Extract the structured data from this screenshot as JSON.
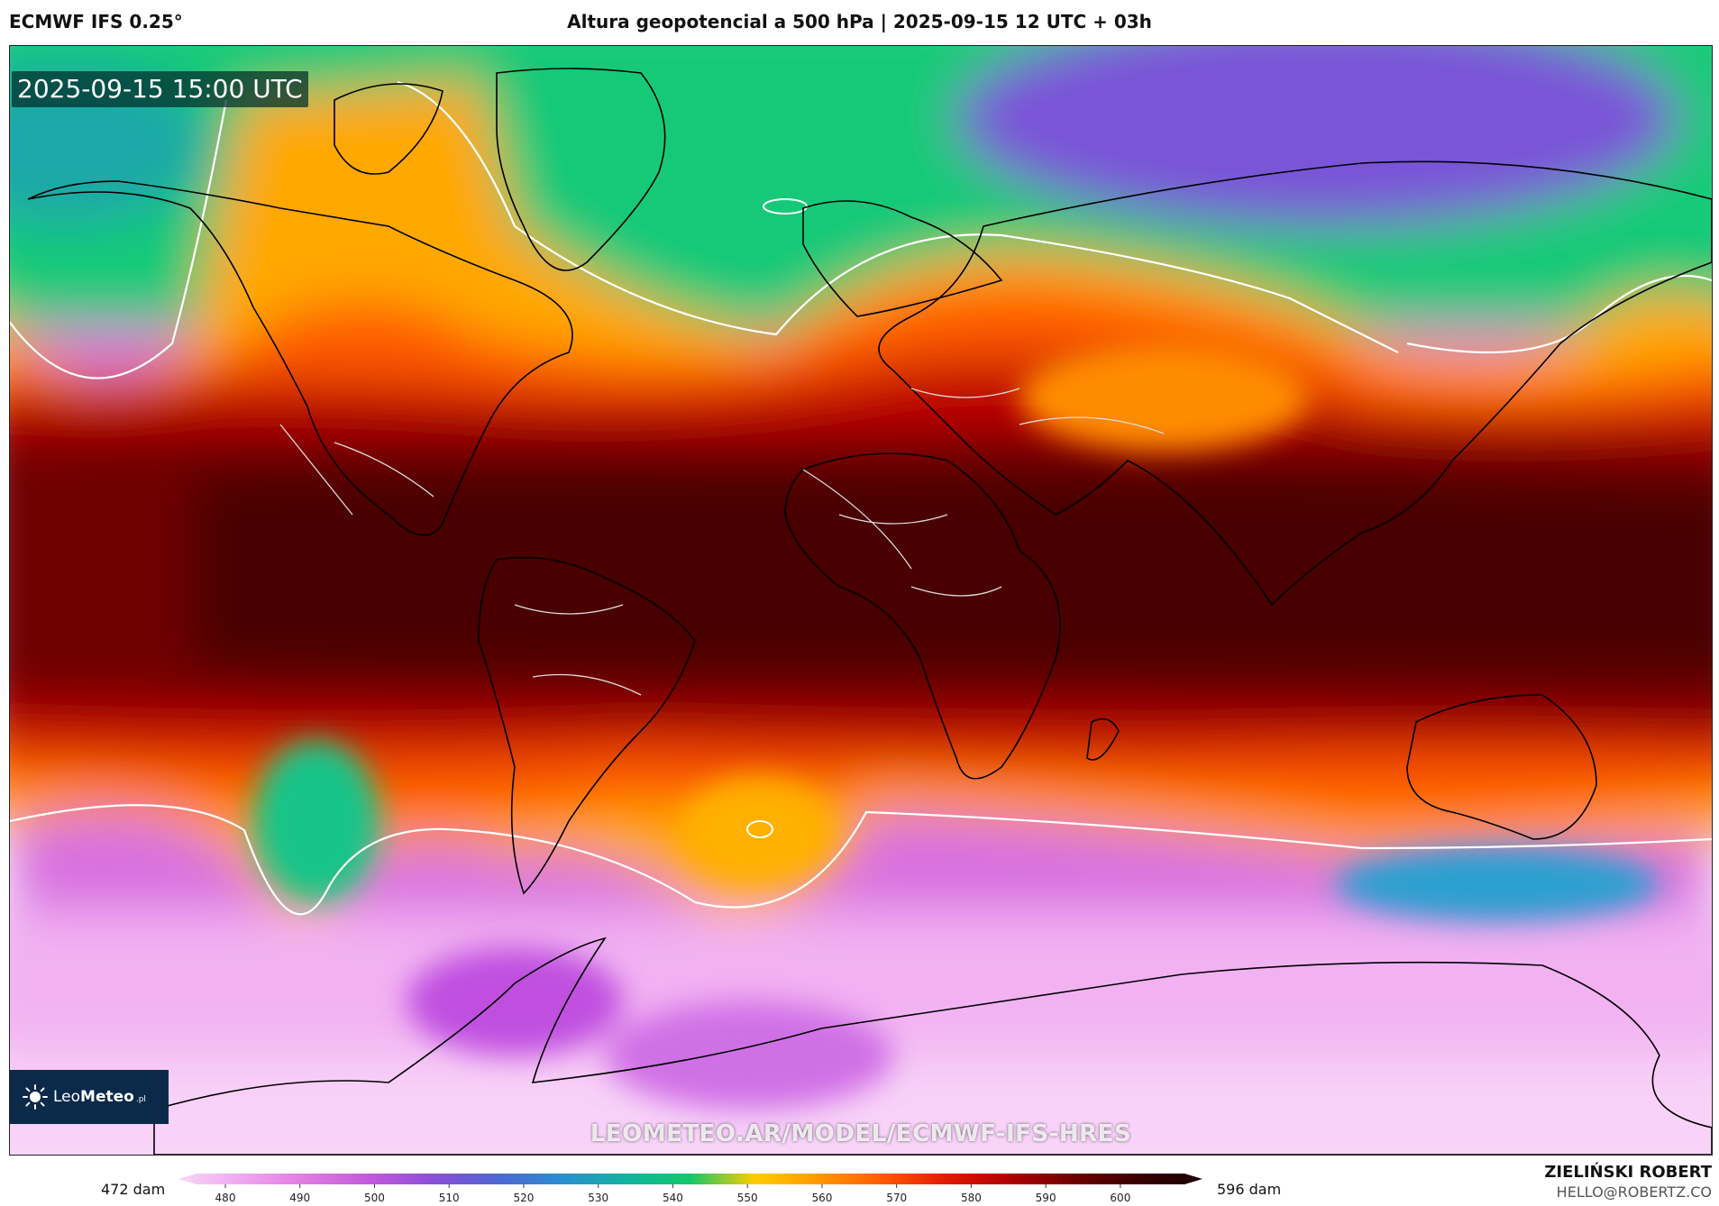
{
  "header": {
    "model": "ECMWF IFS 0.25°",
    "title": "Altura geopotencial a 500 hPa | 2025-09-15 12 UTC + 03h"
  },
  "map": {
    "valid_time": "2025-09-15 15:00 UTC",
    "watermark": "LEOMETEO.AR/MODEL/ECMWF-IFS-HRES",
    "contour_color": "#ffffff"
  },
  "logo": {
    "icon": "sun-icon",
    "brand_light": "Leo",
    "brand_bold": "Meteo",
    "tld": ".pl",
    "background": "#0b2a4a"
  },
  "colorbar": {
    "min_label": "472 dam",
    "max_label": "596 dam",
    "ticks": [
      "480",
      "490",
      "500",
      "510",
      "520",
      "530",
      "540",
      "550",
      "560",
      "570",
      "580",
      "590",
      "600"
    ],
    "colors": [
      "#f7d6f7",
      "#f0a6f0",
      "#e07ae0",
      "#c158dc",
      "#8a4fd8",
      "#4f66d2",
      "#2a8ed0",
      "#12b3a0",
      "#14c76a",
      "#ffcc00",
      "#ff9900",
      "#ff5a00",
      "#e01a00",
      "#b00000",
      "#6e0000",
      "#3a0000",
      "#1a0000"
    ]
  },
  "author": {
    "name": "ZIELIŃSKI ROBERT",
    "email": "HELLO@ROBERTZ.CO"
  }
}
